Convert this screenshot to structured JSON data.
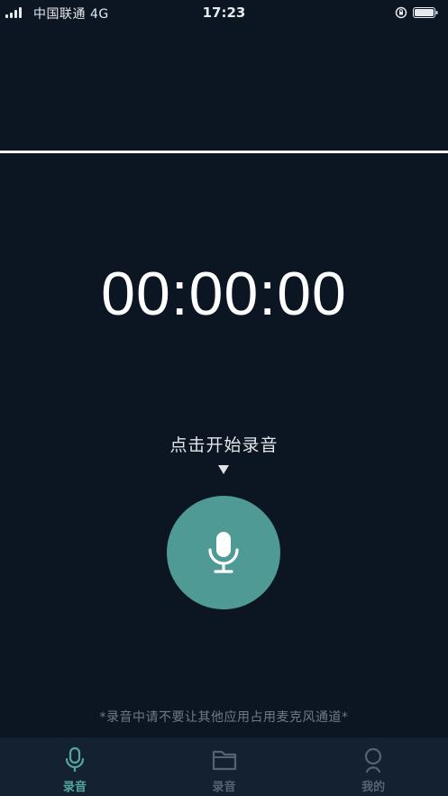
{
  "status_bar": {
    "carrier": "中国联通  4G",
    "time": "17:23"
  },
  "recorder": {
    "timer": "00:00:00",
    "hint": "点击开始录音",
    "notice": "*录音中请不要让其他应用占用麦克风通道*"
  },
  "tab_bar": {
    "tabs": [
      {
        "label": "录音",
        "icon": "microphone-icon",
        "active": true
      },
      {
        "label": "录音",
        "icon": "folder-icon",
        "active": false
      },
      {
        "label": "我的",
        "icon": "profile-icon",
        "active": false
      }
    ]
  },
  "colors": {
    "background": "#0c1522",
    "accent": "#4f9a94",
    "tab_active": "#56a6a0",
    "tab_inactive": "#566372",
    "tab_bar_bg": "#132131"
  }
}
